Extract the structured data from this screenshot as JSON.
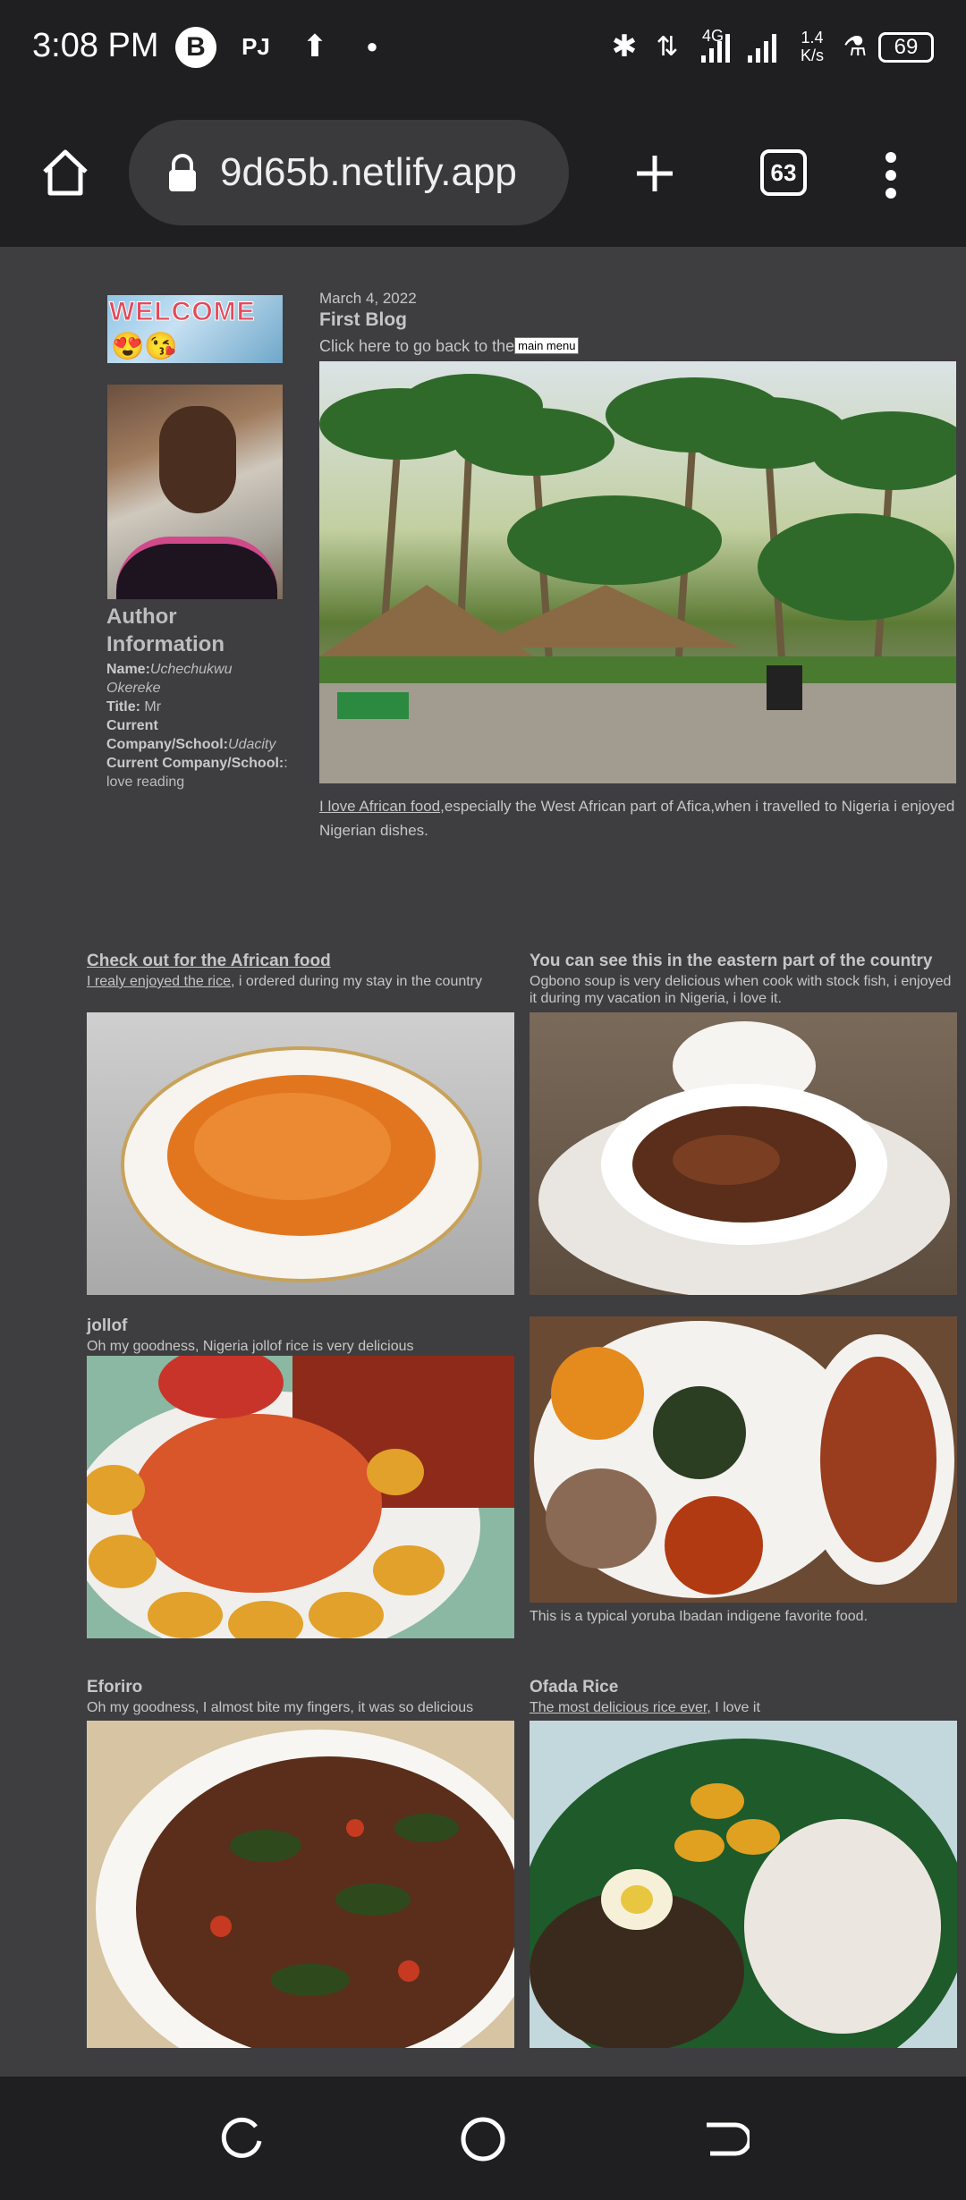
{
  "status_bar": {
    "time": "3:08 PM",
    "speed_value": "1.4",
    "speed_unit": "K/s",
    "battery": "69",
    "network": "4G"
  },
  "browser": {
    "url": "9d65b.netlify.app",
    "tab_count": "63"
  },
  "sidebar": {
    "welcome_text": "WELCOME",
    "welcome_emoji": "😍😘",
    "author_heading": "Author Information",
    "name_label": "Name:",
    "name_value": "Uchechukwu Okereke",
    "title_label": "Title:",
    "title_value": " Mr",
    "company_label": "Current Company/School:",
    "company_value": "Udacity",
    "company2_label": "Current Company/School:",
    "company2_value": ": love reading"
  },
  "blog": {
    "date": "March 4, 2022",
    "title": "First Blog",
    "back_text": "Click here to go back to the",
    "back_button": "main menu",
    "caption_link": "I love African food",
    "caption_rest": ",especially the West African part of Afica,when i travelled to Nigeria i enjoyed Nigerian dishes."
  },
  "foods": {
    "f1": {
      "title": "Check out for the African food",
      "sub_link": "I realy enjoyed the rice",
      "sub_rest": ", i ordered during my stay in the country"
    },
    "f2": {
      "title": "You can see this in the eastern part of the country",
      "sub": "Ogbono soup is very delicious when cook with stock fish, i enjoyed it during my vacation in Nigeria, i love it."
    },
    "f3": {
      "title": "jollof",
      "sub": "Oh my goodness, Nigeria jollof rice is very delicious"
    },
    "f4": {
      "sub": "This is a typical yoruba Ibadan indigene favorite food."
    },
    "f5": {
      "title": "Eforiro",
      "sub": "Oh my goodness, I almost bite my fingers, it was so delicious"
    },
    "f6": {
      "title": "Ofada Rice",
      "sub_link": "The most delicious rice ever",
      "sub_rest": ", I love it"
    }
  }
}
